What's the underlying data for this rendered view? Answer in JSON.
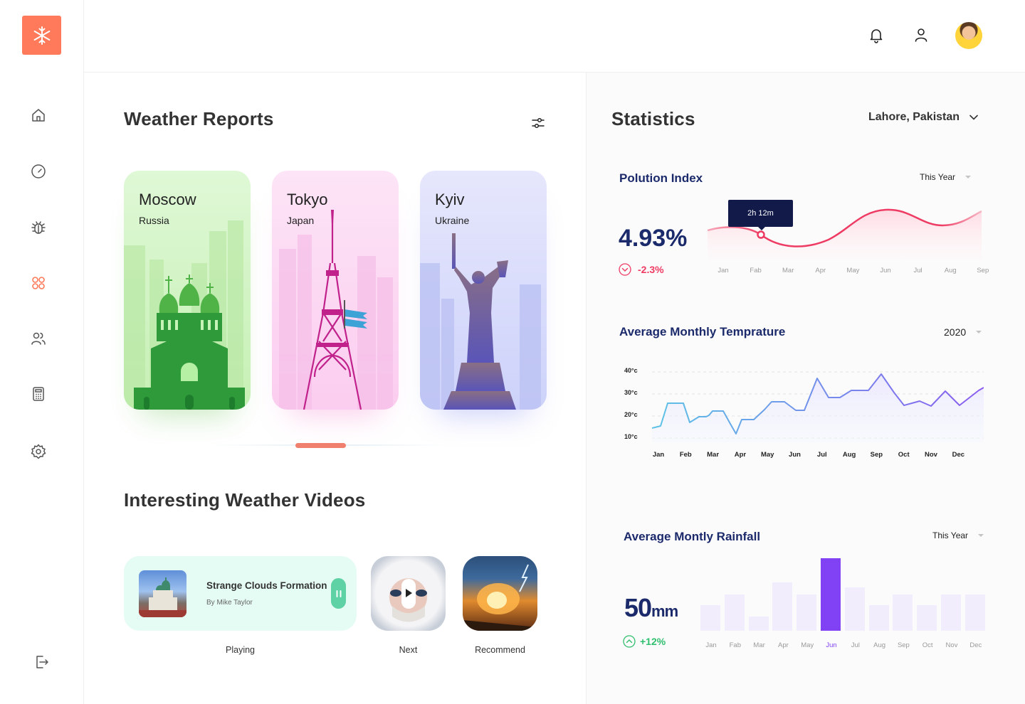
{
  "header": {
    "notification_icon": "bell-icon",
    "profile_icon": "user-icon",
    "avatar": "user-avatar"
  },
  "sidebar": {
    "items": [
      {
        "icon": "home-icon"
      },
      {
        "icon": "speedometer-icon"
      },
      {
        "icon": "bug-icon"
      },
      {
        "icon": "grid-icon",
        "active": true
      },
      {
        "icon": "users-icon"
      },
      {
        "icon": "calculator-icon"
      },
      {
        "icon": "gear-icon"
      },
      {
        "icon": "logout-icon"
      }
    ]
  },
  "weather_reports": {
    "title": "Weather Reports",
    "cards": [
      {
        "city": "Moscow",
        "country": "Russia",
        "color": "#d8f5cf"
      },
      {
        "city": "Tokyo",
        "country": "Japan",
        "color": "#fde0f4"
      },
      {
        "city": "Kyiv",
        "country": "Ukraine",
        "color": "#e1e3fb"
      }
    ]
  },
  "videos": {
    "title": "Interesting Weather Videos",
    "now_playing": {
      "title": "Strange Clouds Formation",
      "author": "By Mike Taylor",
      "label": "Playing"
    },
    "next_label": "Next",
    "recommend_label": "Recommend"
  },
  "statistics": {
    "title": "Statistics",
    "location": "Lahore, Pakistan",
    "pollution": {
      "title": "Polution Index",
      "period": "This Year",
      "value": "4.93%",
      "change": "-2.3%",
      "tooltip": "2h 12m",
      "months": [
        "Jan",
        "Fab",
        "Mar",
        "Apr",
        "May",
        "Jun",
        "Jul",
        "Aug",
        "Sep"
      ]
    },
    "temperature": {
      "title": "Average Monthly Temprature",
      "year": "2020",
      "y_ticks": [
        "40°c",
        "30°c",
        "20°c",
        "10°c"
      ],
      "months": [
        "Jan",
        "Feb",
        "Mar",
        "Apr",
        "May",
        "Jun",
        "Jul",
        "Aug",
        "Sep",
        "Oct",
        "Nov",
        "Dec"
      ]
    },
    "rainfall": {
      "title": "Average Montly Rainfall",
      "period": "This Year",
      "value": "50",
      "unit": "mm",
      "change": "+12%",
      "months": [
        "Jan",
        "Fab",
        "Mar",
        "Apr",
        "May",
        "Jun",
        "Jul",
        "Aug",
        "Sep",
        "Oct",
        "Nov",
        "Dec"
      ],
      "highlight": "Jun",
      "levels": [
        0.35,
        0.5,
        0.2,
        0.67,
        0.5,
        1.0,
        0.6,
        0.35,
        0.5,
        0.35,
        0.5,
        0.5
      ]
    }
  },
  "colors": {
    "accent": "#ff7a5a",
    "navy": "#1b2a6b",
    "pink": "#ee3b63",
    "purple": "#8142f5",
    "green": "#2fbf6e"
  }
}
